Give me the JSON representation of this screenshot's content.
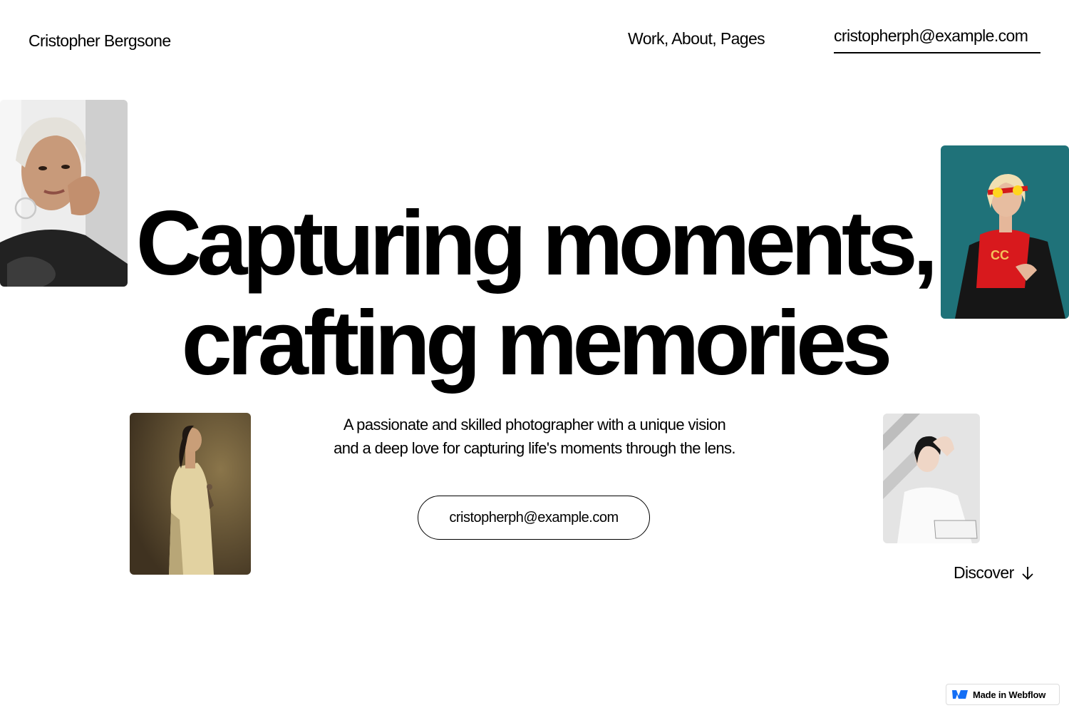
{
  "header": {
    "brand": "Cristopher Bergsone",
    "nav": "Work, About, Pages",
    "email": "cristopherph@example.com"
  },
  "hero": {
    "line1": "Capturing moments,",
    "line2": "crafting memories"
  },
  "intro": {
    "line1": "A passionate and skilled photographer with a unique vision",
    "line2": "and a deep love for capturing life's moments through the lens."
  },
  "cta": {
    "email": "cristopherph@example.com"
  },
  "discover": {
    "label": "Discover",
    "icon": "arrow-down-icon"
  },
  "badge": {
    "label": "Made in Webflow",
    "icon": "webflow-logo-icon"
  },
  "photos": [
    {
      "name": "portrait-woman-silver-hair",
      "palette": [
        "#e9e9e9",
        "#2a2a2a"
      ]
    },
    {
      "name": "portrait-woman-red-shirt",
      "palette": [
        "#1c6f78",
        "#d9191c"
      ]
    },
    {
      "name": "portrait-woman-beige-coat",
      "palette": [
        "#5b4a2e",
        "#e3d4a6"
      ]
    },
    {
      "name": "portrait-woman-white-shirt",
      "palette": [
        "#d8d8d8",
        "#ffffff"
      ]
    }
  ]
}
